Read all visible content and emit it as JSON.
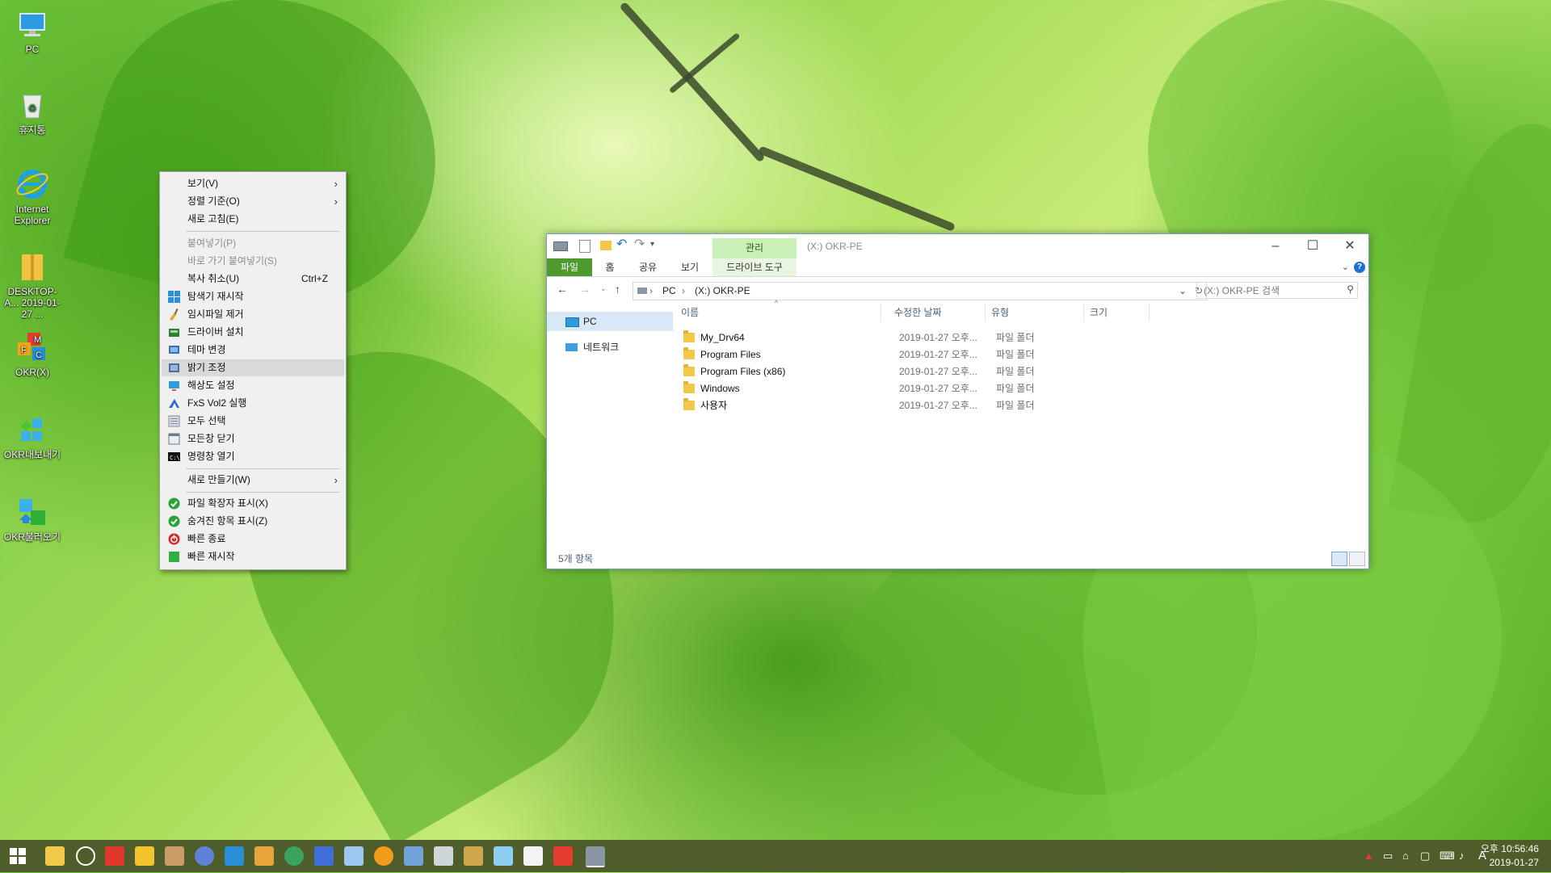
{
  "desktop": {
    "icons": [
      {
        "label": "PC",
        "icon": "pc-icon"
      },
      {
        "label": "휴지통",
        "icon": "recycle-bin-icon"
      },
      {
        "label": "Internet Explorer",
        "icon": "ie-icon"
      },
      {
        "label": "DESKTOP-A... 2019-01-27 ...",
        "icon": "folder-zip-icon"
      },
      {
        "label": "OKR(X)",
        "icon": "okr-icon"
      },
      {
        "label": "OKR내보내기",
        "icon": "okr-export-icon"
      },
      {
        "label": "OKR불러오기",
        "icon": "okr-import-icon"
      }
    ]
  },
  "context_menu": {
    "items": [
      {
        "label": "보기(V)",
        "submenu": true
      },
      {
        "label": "정렬 기준(O)",
        "submenu": true
      },
      {
        "label": "새로 고침(E)"
      },
      {
        "label": "붙여넣기(P)",
        "disabled": true
      },
      {
        "label": "바로 가기 붙여넣기(S)",
        "disabled": true
      },
      {
        "label": "복사 취소(U)",
        "shortcut": "Ctrl+Z"
      },
      {
        "label": "탐색기 재시작",
        "icon": "windows-explorer-icon"
      },
      {
        "label": "임시파일 제거",
        "icon": "broom-icon"
      },
      {
        "label": "드라이버 설치",
        "icon": "driver-install-icon"
      },
      {
        "label": "테마 변경",
        "icon": "theme-icon"
      },
      {
        "label": "밝기 조정",
        "icon": "brightness-icon",
        "highlighted": true
      },
      {
        "label": "해상도 설정",
        "icon": "resolution-icon"
      },
      {
        "label": "FxS Vol2 실행",
        "icon": "fxs-icon"
      },
      {
        "label": "모두 선택",
        "icon": "select-all-icon"
      },
      {
        "label": "모든창 닫기",
        "icon": "close-all-icon"
      },
      {
        "label": "명령창 열기",
        "icon": "cmd-icon"
      },
      {
        "label": "새로 만들기(W)",
        "submenu": true
      },
      {
        "label": "파일 확장자 표시(X)",
        "icon": "check-green-icon"
      },
      {
        "label": "숨겨진 항목 표시(Z)",
        "icon": "check-green-icon"
      },
      {
        "label": "빠른 종료",
        "icon": "power-icon"
      },
      {
        "label": "빠른 재시작",
        "icon": "restart-icon"
      }
    ]
  },
  "explorer": {
    "title": "(X:) OKR-PE",
    "contextual_tab": "관리",
    "tabs": [
      "파일",
      "홈",
      "공유",
      "보기",
      "드라이브 도구"
    ],
    "address": {
      "parts": [
        "PC",
        "(X:) OKR-PE"
      ]
    },
    "search_placeholder": "(X:) OKR-PE 검색",
    "nav": [
      "PC",
      "네트워크"
    ],
    "columns": [
      "이름",
      "수정한 날짜",
      "유형",
      "크기"
    ],
    "rows": [
      {
        "name": "My_Drv64",
        "date": "2019-01-27 오후...",
        "type": "파일 폴더"
      },
      {
        "name": "Program Files",
        "date": "2019-01-27 오후...",
        "type": "파일 폴더"
      },
      {
        "name": "Program Files (x86)",
        "date": "2019-01-27 오후...",
        "type": "파일 폴더"
      },
      {
        "name": "Windows",
        "date": "2019-01-27 오후...",
        "type": "파일 폴더"
      },
      {
        "name": "사용자",
        "date": "2019-01-27 오후...",
        "type": "파일 폴더"
      }
    ],
    "status": "5개 항목",
    "help": "?"
  },
  "taskbar": {
    "time": "오후 10:56:46",
    "date": "2019-01-27",
    "ime": "A",
    "bg": "#4f5d2a"
  }
}
